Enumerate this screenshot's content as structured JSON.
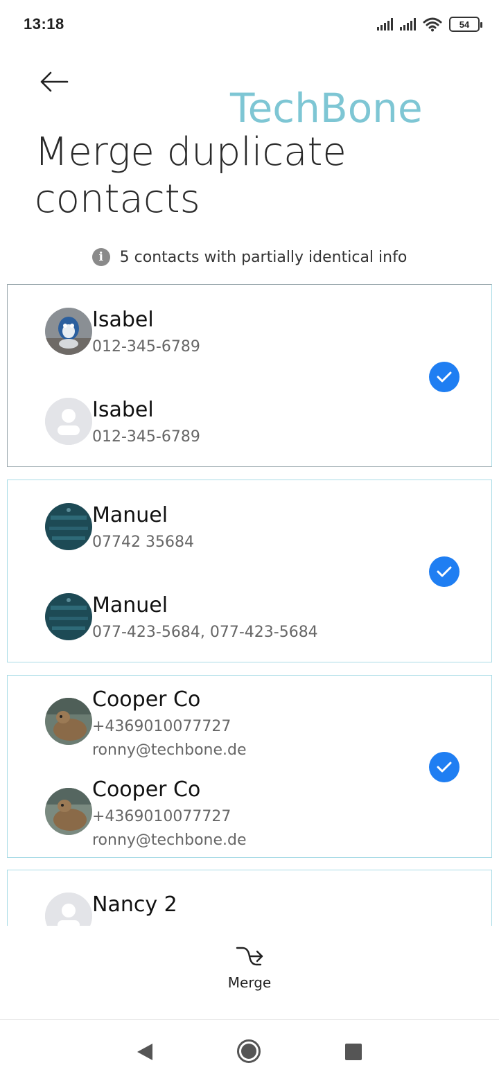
{
  "status": {
    "time": "13:18",
    "battery": "54"
  },
  "header": {
    "watermark": "TechBone",
    "title": "Merge duplicate contacts"
  },
  "info": {
    "text": "5 contacts with partially identical info"
  },
  "groups": [
    {
      "contacts": [
        {
          "name": "Isabel",
          "lines": [
            "012-345-6789"
          ],
          "avatar": "penguin-photo"
        },
        {
          "name": "Isabel",
          "lines": [
            "012-345-6789"
          ],
          "avatar": "default-person"
        }
      ]
    },
    {
      "contacts": [
        {
          "name": "Manuel",
          "lines": [
            "07742 35684"
          ],
          "avatar": "teal-photo"
        },
        {
          "name": "Manuel",
          "lines": [
            "077-423-5684, 077-423-5684"
          ],
          "avatar": "teal-photo"
        }
      ]
    },
    {
      "contacts": [
        {
          "name": "Cooper Co",
          "lines": [
            "+4369010077727",
            "ronny@techbone.de"
          ],
          "avatar": "dog-photo"
        },
        {
          "name": "Cooper Co",
          "lines": [
            "+4369010077727",
            "ronny@techbone.de"
          ],
          "avatar": "dog-photo"
        }
      ]
    },
    {
      "contacts": [
        {
          "name": "Nancy 2",
          "lines": [],
          "avatar": "default-person"
        }
      ]
    }
  ],
  "actions": {
    "merge_label": "Merge"
  },
  "colors": {
    "accent": "#1f7ef2",
    "watermark": "#7ec6d4"
  }
}
